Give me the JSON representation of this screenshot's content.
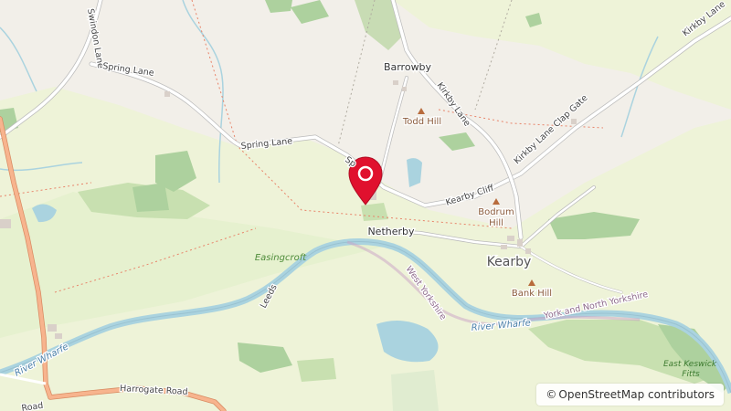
{
  "map": {
    "place_labels": {
      "barrowby": "Barrowby",
      "todd_hill": "Todd Hill",
      "netherby": "Netherby",
      "kearby": "Kearby",
      "bodrum": "Bodrum",
      "hill": "Hill",
      "bank_hill": "Bank Hill",
      "easingcroft": "Easingcroft",
      "east": "East Keswick",
      "fitts": "Fitts"
    },
    "road_labels": {
      "swindon_lane": "Swindon Lane",
      "spring_lane_1": "Spring Lane",
      "spring_lane_2": "Spring Lane",
      "sp": "Sp",
      "kirkby_lane_1": "Kirkby Lane",
      "kirkby_lane_2": "Kirkby Lane",
      "kirkby_lane_clap_gate": "Kirkby Lane Clap Gate",
      "kearby_cliff": "Kearby Cliff",
      "harrogate_road": "Harrogate Road",
      "road_partial": "Road",
      "leeds": "Leeds",
      "west_yorkshire": "West Yorkshire",
      "york_north": "York and North Yorkshire"
    },
    "river_labels": {
      "river_wharfe_1": "River Wharfe",
      "river_wharfe_2": "River Wharfe"
    },
    "marker_icon": "location-pin-icon",
    "peak_icon": "peak-triangle-icon",
    "colors": {
      "background": "#f2efe9",
      "grass": "#e6f1cf",
      "wood": "#add19e",
      "water": "#aad3df",
      "road_primary": "#f2a680",
      "marker": "#e0112e"
    }
  },
  "attribution": {
    "symbol": "©",
    "text": "OpenStreetMap contributors"
  }
}
